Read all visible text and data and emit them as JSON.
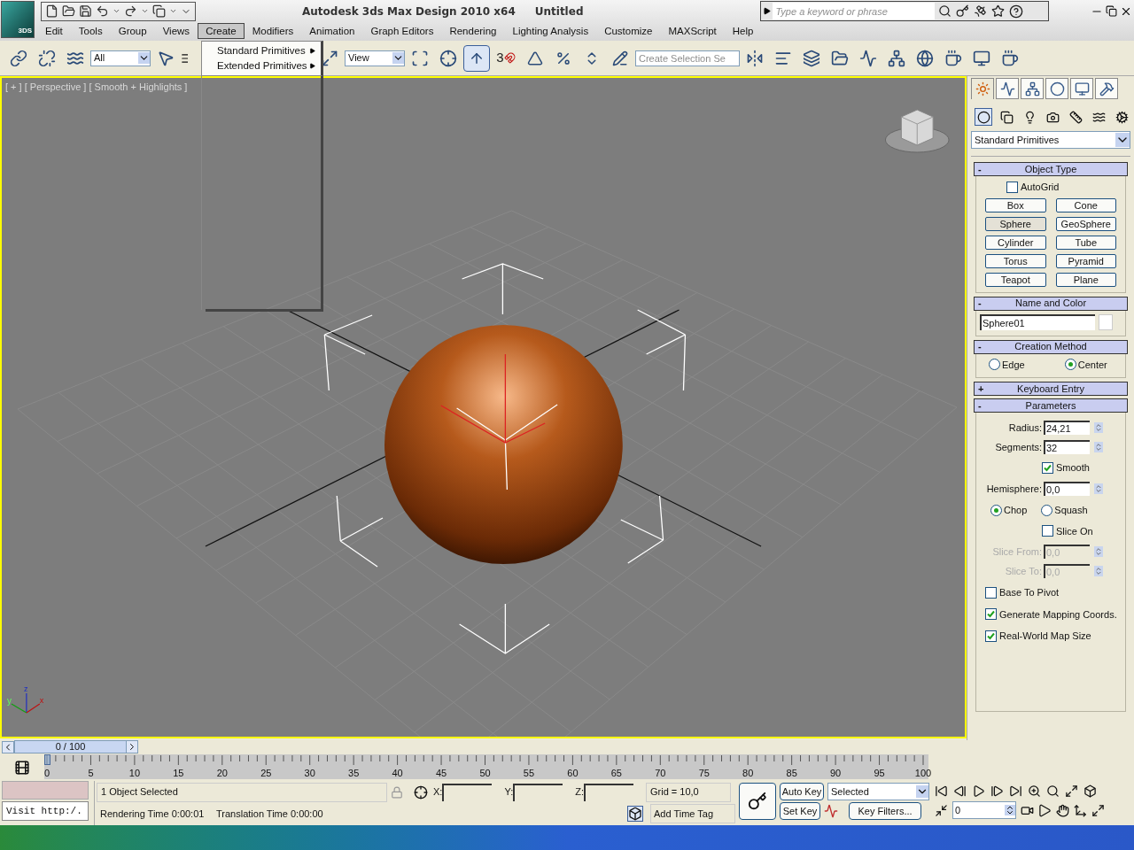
{
  "title_bar": {
    "app_badge": "3DS",
    "title": "Autodesk 3ds Max Design 2010 x64",
    "document": "Untitled",
    "search": {
      "placeholder": "Type a keyword or phrase"
    }
  },
  "menu_bar": [
    {
      "label": "Edit",
      "selected": false
    },
    {
      "label": "Tools",
      "selected": false
    },
    {
      "label": "Group",
      "selected": false
    },
    {
      "label": "Views",
      "selected": false
    },
    {
      "label": "Create",
      "selected": true
    },
    {
      "label": "Modifiers",
      "selected": false
    },
    {
      "label": "Animation",
      "selected": false
    },
    {
      "label": "Graph Editors",
      "selected": false
    },
    {
      "label": "Rendering",
      "selected": false
    },
    {
      "label": "Lighting Analysis",
      "selected": false
    },
    {
      "label": "Customize",
      "selected": false
    },
    {
      "label": "MAXScript",
      "selected": false
    },
    {
      "label": "Help",
      "selected": false
    }
  ],
  "open_menu": {
    "items": [
      {
        "label": "Standard Primitives",
        "submenu": true
      },
      {
        "label": "Extended Primitives",
        "submenu": true
      }
    ]
  },
  "toolbar": {
    "selection_filter": "All",
    "reference_coordinate": "View",
    "snap_dimension": "3",
    "selection_set": {
      "placeholder": "Create Selection Se"
    }
  },
  "viewport": {
    "label": "[ + ] [ Perspective ] [ Smooth + Highlights ]",
    "axis_labels": [
      "z",
      "y",
      "x"
    ]
  },
  "command_panel": {
    "tabs": [
      {
        "selected": true
      },
      {
        "selected": false
      },
      {
        "selected": false
      },
      {
        "selected": false
      },
      {
        "selected": false
      },
      {
        "selected": false
      }
    ],
    "categories": [
      {
        "selected": true
      },
      {
        "selected": false
      },
      {
        "selected": false
      },
      {
        "selected": false
      },
      {
        "selected": false
      },
      {
        "selected": false
      },
      {
        "selected": false
      }
    ],
    "category_dropdown": "Standard Primitives",
    "object_type": {
      "title": "Object Type",
      "toggle": "-",
      "autogrid": {
        "label": "AutoGrid",
        "checked": false
      },
      "buttons": [
        {
          "label": "Box",
          "selected": false
        },
        {
          "label": "Cone",
          "selected": false
        },
        {
          "label": "Sphere",
          "selected": true
        },
        {
          "label": "GeoSphere",
          "selected": false
        },
        {
          "label": "Cylinder",
          "selected": false
        },
        {
          "label": "Tube",
          "selected": false
        },
        {
          "label": "Torus",
          "selected": false
        },
        {
          "label": "Pyramid",
          "selected": false
        },
        {
          "label": "Teapot",
          "selected": false
        },
        {
          "label": "Plane",
          "selected": false
        }
      ]
    },
    "name_and_color": {
      "title": "Name and Color",
      "toggle": "-",
      "name": "Sphere01"
    },
    "creation_method": {
      "title": "Creation Method",
      "toggle": "-",
      "options": [
        {
          "label": "Edge",
          "selected": false
        },
        {
          "label": "Center",
          "selected": true
        }
      ]
    },
    "keyboard_entry": {
      "title": "Keyboard Entry",
      "toggle": "+"
    },
    "parameters": {
      "title": "Parameters",
      "toggle": "-",
      "rows": [
        {
          "kind": "spinner",
          "label": "Radius:",
          "value": "24,21",
          "disabled": false
        },
        {
          "kind": "spinner",
          "label": "Segments:",
          "value": "32",
          "disabled": false
        },
        {
          "kind": "inline_checkbox",
          "label": "Smooth",
          "checked": true
        },
        {
          "kind": "spinner",
          "label": "Hemisphere:",
          "value": "0,0",
          "disabled": false
        },
        {
          "kind": "radio_group",
          "options": [
            {
              "label": "Chop",
              "selected": true
            },
            {
              "label": "Squash",
              "selected": false
            }
          ]
        },
        {
          "kind": "inline_checkbox",
          "label": "Slice On",
          "checked": false
        },
        {
          "kind": "spinner",
          "label": "Slice From:",
          "value": "0,0",
          "disabled": true
        },
        {
          "kind": "spinner",
          "label": "Slice To:",
          "value": "0,0",
          "disabled": true
        },
        {
          "kind": "checkbox",
          "label": "Base To Pivot",
          "checked": false
        },
        {
          "kind": "checkbox",
          "label": "Generate Mapping Coords.",
          "checked": true
        },
        {
          "kind": "checkbox",
          "label": "Real-World Map Size",
          "checked": true
        }
      ]
    }
  },
  "time_slider": {
    "label": "0 / 100",
    "level": 0
  },
  "ruler_labels": [
    "0",
    "5",
    "10",
    "15",
    "20",
    "25",
    "30",
    "35",
    "40",
    "45",
    "50",
    "55",
    "60",
    "65",
    "70",
    "75",
    "80",
    "85",
    "90",
    "95",
    "100"
  ],
  "status": {
    "listener": "Visit http:/.",
    "selection": "1 Object Selected",
    "x_label": "X:",
    "y_label": "Y:",
    "z_label": "Z:",
    "grid": "Grid = 10,0",
    "rendering_time": "Rendering Time  0:00:01",
    "translation_time": "Translation Time  0:00:00",
    "time_tag": "Add Time Tag"
  },
  "animation": {
    "auto_key": {
      "label": "Auto Key",
      "on": false
    },
    "set_key": "Set Key",
    "key_mode": "Selected",
    "key_filters": "Key Filters...",
    "frame": "0"
  }
}
